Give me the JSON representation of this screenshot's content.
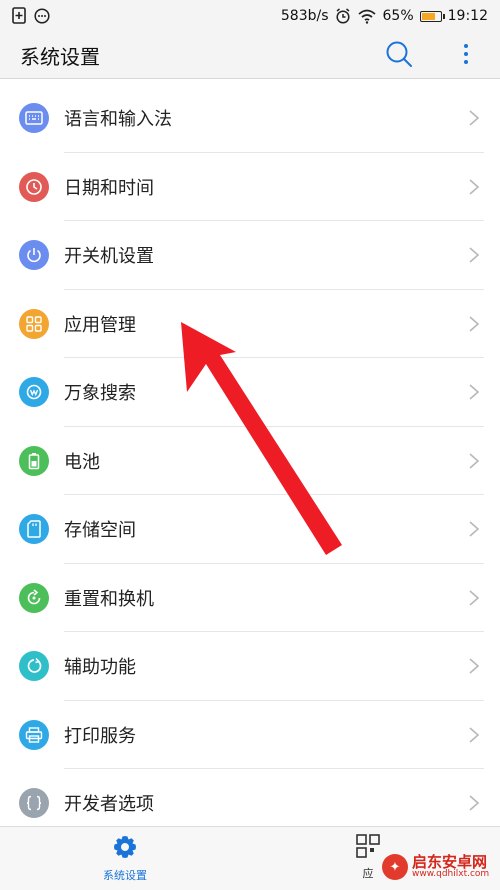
{
  "status_bar": {
    "net_speed": "583b/s",
    "battery": "65%",
    "battery_level": 0.65,
    "time": "19:12",
    "icons": [
      "sim-icon",
      "notification-icon",
      "alarm-icon",
      "wifi-icon",
      "battery-icon"
    ]
  },
  "app_bar": {
    "title": "系统设置",
    "search_icon": "search-icon",
    "more_icon": "more-vert-icon",
    "accent": "#1a73d9"
  },
  "settings": {
    "items": [
      {
        "label": "语言和输入法",
        "icon": "keyboard-icon",
        "color": "#6b8df0"
      },
      {
        "label": "日期和时间",
        "icon": "clock-icon",
        "color": "#e15a55"
      },
      {
        "label": "开关机设置",
        "icon": "power-icon",
        "color": "#6b8df0"
      },
      {
        "label": "应用管理",
        "icon": "apps-grid-icon",
        "color": "#f2a531"
      },
      {
        "label": "万象搜索",
        "icon": "search-w-icon",
        "color": "#2fa8e6"
      },
      {
        "label": "电池",
        "icon": "battery-icon",
        "color": "#4cbf5a"
      },
      {
        "label": "存储空间",
        "icon": "sd-card-icon",
        "color": "#2fa8e6"
      },
      {
        "label": "重置和换机",
        "icon": "reset-icon",
        "color": "#4cbf5a"
      },
      {
        "label": "辅助功能",
        "icon": "accessibility-icon",
        "color": "#2fbfc9"
      },
      {
        "label": "打印服务",
        "icon": "printer-icon",
        "color": "#2fa8e6"
      },
      {
        "label": "开发者选项",
        "icon": "code-braces-icon",
        "color": "#9aa4ae"
      }
    ]
  },
  "bottom_nav": {
    "tab_settings": "系统设置",
    "tab_apps_partial": "应"
  },
  "watermark": {
    "name": "启东安卓网",
    "url": "www.qdhilxt.com"
  }
}
